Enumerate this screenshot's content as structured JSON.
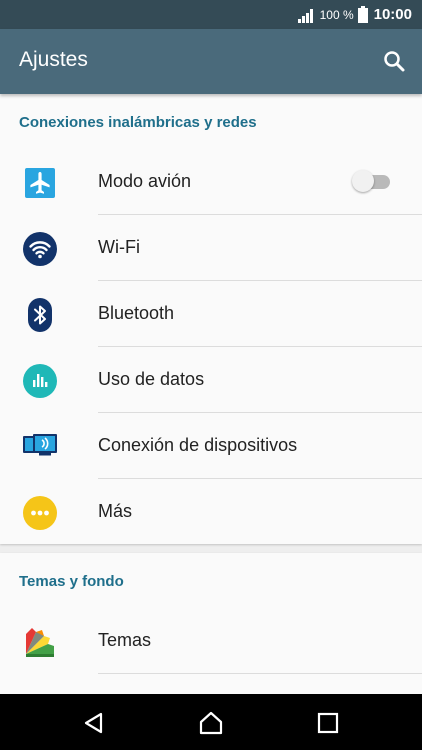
{
  "status_bar": {
    "battery_percent": "100 %",
    "time": "10:00"
  },
  "app_bar": {
    "title": "Ajustes",
    "search_icon": "search-icon"
  },
  "sections": [
    {
      "header": "Conexiones inalámbricas y redes",
      "items": [
        {
          "label": "Modo avión",
          "icon": "airplane-icon",
          "toggle": "off"
        },
        {
          "label": "Wi-Fi",
          "icon": "wifi-icon"
        },
        {
          "label": "Bluetooth",
          "icon": "bluetooth-icon"
        },
        {
          "label": "Uso de datos",
          "icon": "data-usage-icon"
        },
        {
          "label": "Conexión de dispositivos",
          "icon": "device-connection-icon"
        },
        {
          "label": "Más",
          "icon": "more-icon"
        }
      ]
    },
    {
      "header": "Temas y fondo",
      "items": [
        {
          "label": "Temas",
          "icon": "themes-icon"
        }
      ]
    }
  ],
  "colors": {
    "status_bar": "#344b56",
    "app_bar": "#4a6a7b",
    "section_header": "#1f6f8b",
    "airplane": "#29a5e0",
    "wifi": "#12336a",
    "data_usage": "#1fb8b7",
    "more": "#f5c518"
  }
}
